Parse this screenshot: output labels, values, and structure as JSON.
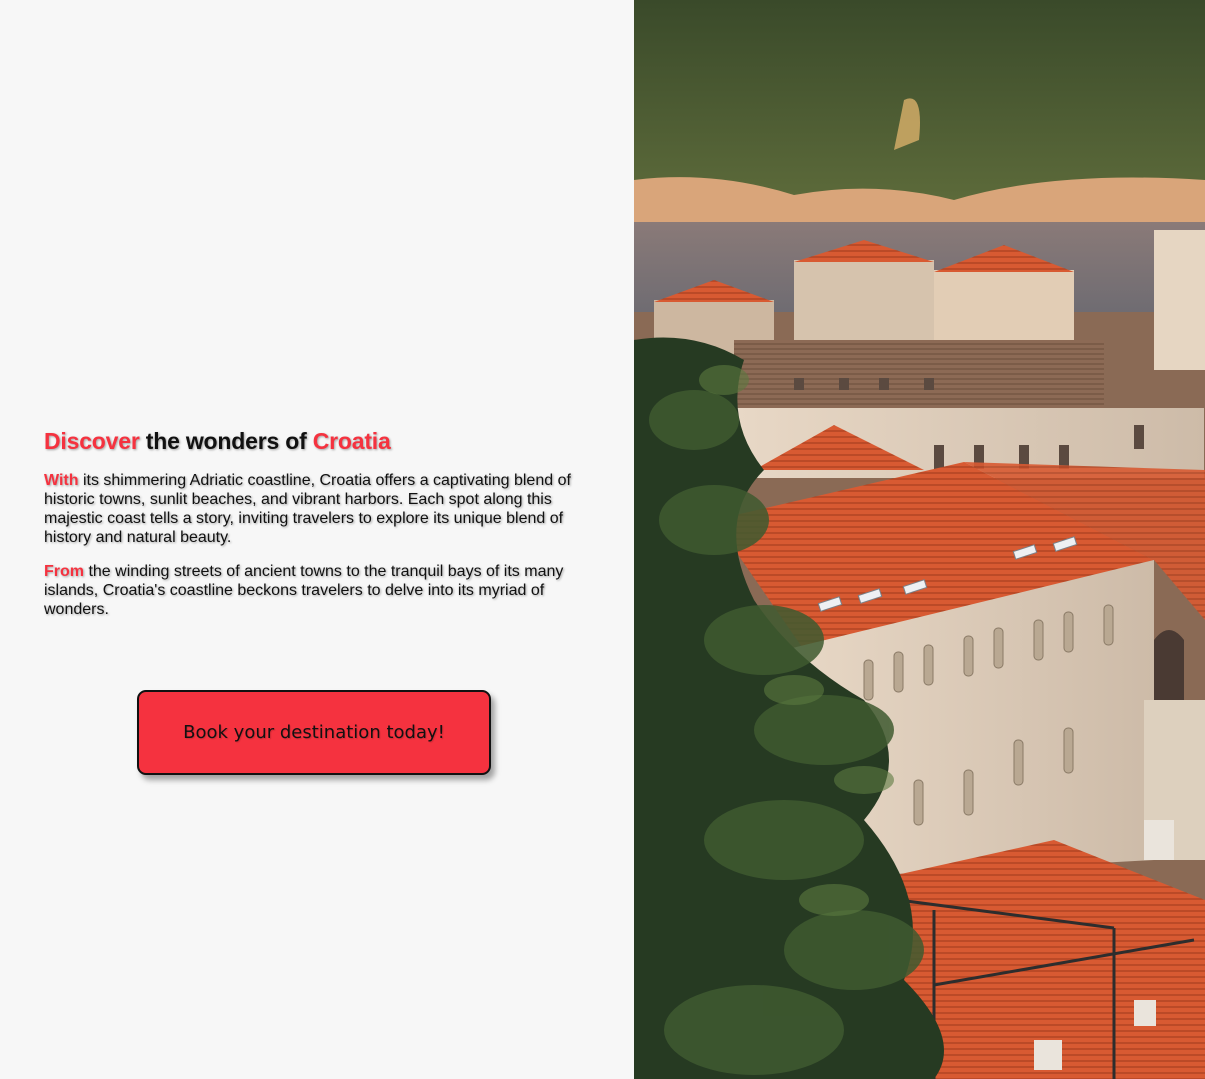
{
  "hero": {
    "title_part1": "Discover",
    "title_part2": " the wonders of ",
    "title_part3": "Croatia",
    "p1_lead": "With",
    "p1_rest": " its shimmering Adriatic coastline, Croatia offers a captivating blend of historic towns, sunlit beaches, and vibrant harbors. Each spot along this majestic coast tells a story, inviting travelers to explore its unique blend of history and natural beauty.",
    "p2_lead": "From",
    "p2_rest": " the winding streets of ancient towns to the tranquil bays of its many islands, Croatia's coastline beckons travelers to delve into its myriad of wonders.",
    "cta_label": "Book your destination today!"
  },
  "colors": {
    "accent": "#f5323f",
    "background": "#f7f7f7",
    "text": "#111111"
  }
}
